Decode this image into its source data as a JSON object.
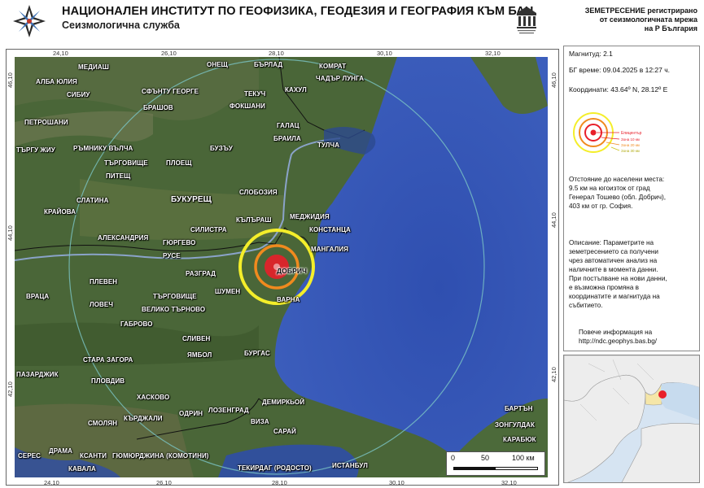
{
  "header": {
    "title": "НАЦИОНАЛЕН ИНСТИТУТ ПО ГЕОФИЗИКА, ГЕОДЕЗИЯ И ГЕОГРАФИЯ КЪМ БАН",
    "subtitle": "Сеизмологична служба",
    "right_text_1": "ЗЕМЕТРЕСЕНИЕ регистрирано",
    "right_text_2": "от сеизмологичната мрежа",
    "right_text_3": "на Р България"
  },
  "ticks": {
    "top": [
      "24,10",
      "26,10",
      "28,10",
      "30,10",
      "32,10"
    ],
    "bottom": [
      "24,10",
      "26,10",
      "28,10",
      "30,10",
      "32,10"
    ],
    "left": [
      "46,10",
      "44,10",
      "42,10"
    ],
    "right": [
      "46,10",
      "44,10",
      "42,10"
    ]
  },
  "cities": {
    "medias": "МЕДИАШ",
    "alba_iulia": "АЛБА ЮЛИЯ",
    "sibiu": "СИБИУ",
    "petroshani": "ПЕТРОШАНИ",
    "targu_jiu": "ТЪРГУ ЖИУ",
    "ramnicu": "РЪМНИКУ ВЪЛЧА",
    "pitesti": "ПИТЕЩ",
    "targoviste_ro": "ТЪРГОВИЩЕ",
    "ploesti": "ПЛОЕЩ",
    "brasov": "БРАШОВ",
    "sf_gheorghe": "СФЪНТУ ГЕОРГЕ",
    "onest": "ОНЕЩ",
    "barlad": "БЪРЛАД",
    "komrat": "КОМРАТ",
    "chadyr": "ЧАДЪР ЛУНГА",
    "kahul": "КАХУЛ",
    "tekuch": "ТЕКУЧ",
    "fokshani": "ФОКШАНИ",
    "galati": "ГАЛАЦ",
    "braila": "БРАИЛА",
    "tulcea": "ТУЛЧА",
    "buzau": "БУЗЪУ",
    "bucharest": "БУКУРЕЩ",
    "slobozia": "СЛОБОЗИЯ",
    "slatina": "СЛАТИНА",
    "craiova": "КРАЙОВА",
    "alexandria": "АЛЕКСАНДРИЯ",
    "giurgiu": "ГЮРГЕВО",
    "kalarash": "КЪЛЪРАШ",
    "silistra": "СИЛИСТРА",
    "medgidia": "МЕДЖИДИЯ",
    "constanta": "КОНСТАНЦА",
    "mangalia": "МАНГАЛИЯ",
    "ruse": "РУСЕ",
    "razgrad": "РАЗГРАД",
    "dobrich": "ДОБРИЧ",
    "pleven": "ПЛЕВЕН",
    "vratsa": "ВРАЦА",
    "lovech": "ЛОВЕЧ",
    "targoviste_bg": "ТЪРГОВИЩЕ",
    "shumen": "ШУМЕН",
    "varna": "ВАРНА",
    "v_tarnovo": "ВЕЛИКО ТЪРНОВО",
    "gabrovo": "ГАБРОВО",
    "sliven": "СЛИВЕН",
    "stara_zagora": "СТАРА ЗАГОРА",
    "yambol": "ЯМБОЛ",
    "burgas": "БУРГАС",
    "pazardzhik": "ПАЗАРДЖИК",
    "plovdiv": "ПЛОВДИВ",
    "haskovo": "ХАСКОВО",
    "edirne": "ОДРИН",
    "kardzhali": "КЪРДЖАЛИ",
    "smolyan": "СМОЛЯН",
    "kirklareli": "ЛОЗЕНГРАД",
    "demirkoy": "ДЕМИРКЬОЙ",
    "vize": "ВИЗА",
    "saray": "САРАЙ",
    "seres": "СЕРЕС",
    "drama": "ДРАМА",
    "xanthi": "КСАНТИ",
    "komotini": "ГЮМЮРДЖИНА (КОМОТИНИ)",
    "kavala": "КАВАЛА",
    "tekirdag": "ТЕКИРДАГ (РОДОСТО)",
    "istanbul": "ИСТАНБУЛ",
    "bartin": "БАРТЪН",
    "zonguldak": "ЗОНГУЛДАК",
    "karabuk": "КАРАБЮК"
  },
  "scale": {
    "l0": "0",
    "l1": "50",
    "l2": "100 км"
  },
  "panel": {
    "magnitude": "Магнитуд: 2.1",
    "time": "БГ време: 09.04.2025 в 12:27 ч.",
    "coords": "Координати: 43.64º N, 28.12º E",
    "legend": [
      "Епицентър",
      "Зона 10 км",
      "Зона 20 км",
      "Зона 30 км"
    ],
    "distance": [
      "Отстояние до населени места:",
      "9.5 км на югоизток от град",
      "Генерал Тошево (обл. Добрич),",
      "403 км от гр. София."
    ],
    "description": [
      "Описание: Параметрите на",
      "земетресението са получени",
      "чрез автоматичен анализ на",
      "наличните в момента данни.",
      "При постъпване на нови данни,",
      "е възможна промяна в",
      "координатите и магнитуда на",
      "събитието."
    ],
    "more_1": "Повече информация на",
    "more_2": "http://ndc.geophys.bas.bg/"
  },
  "colors": {
    "sea": "#3554a8",
    "land": "#4c6a3a",
    "epicenter": "#e81f2a",
    "zone_inner": "#f08a1e",
    "zone_outer": "#f4ee2a"
  }
}
